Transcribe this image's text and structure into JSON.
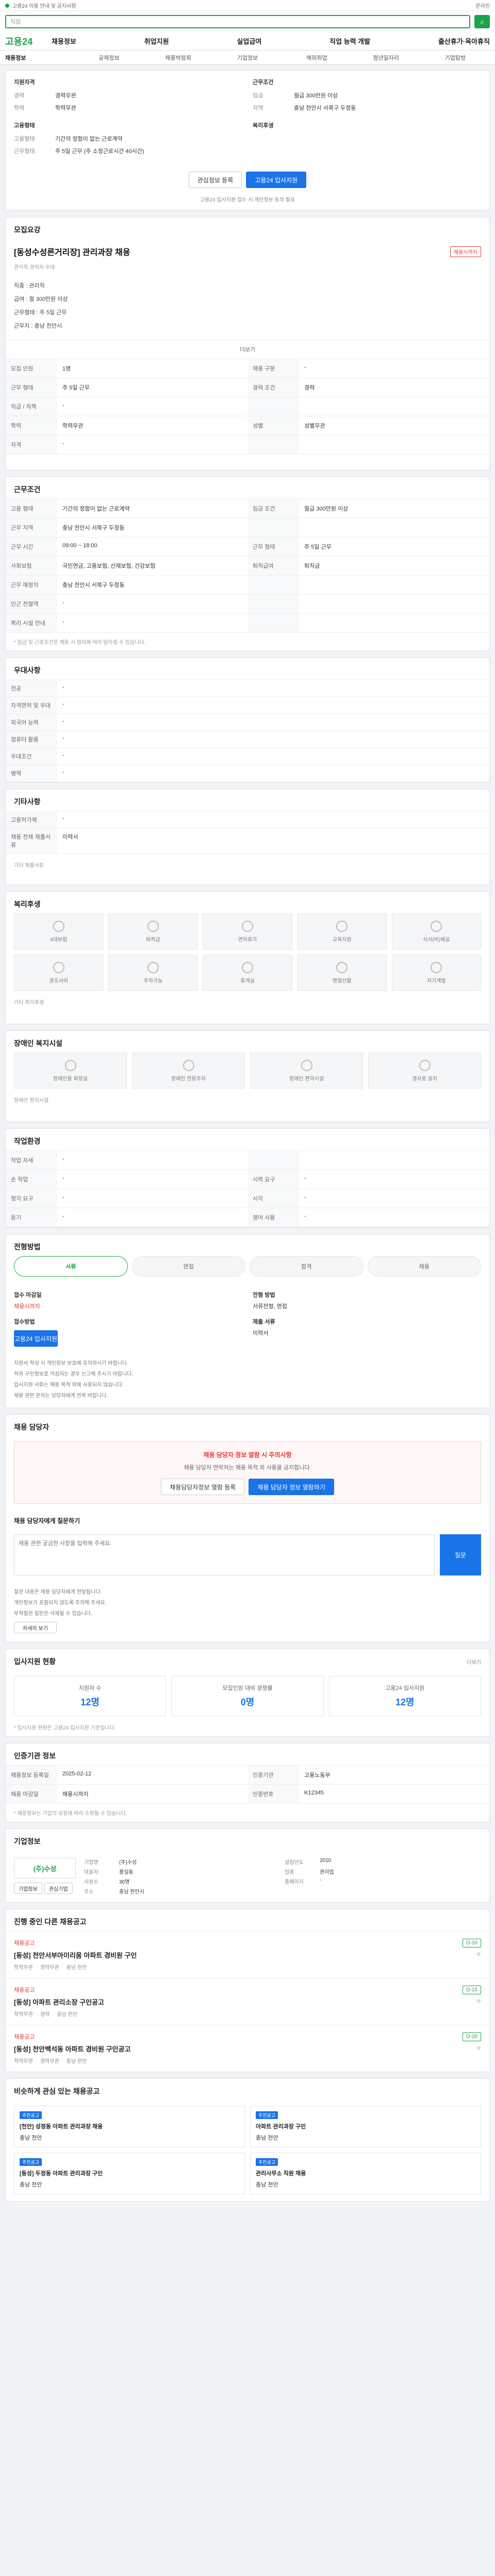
{
  "topbar": {
    "notice": "고용24 이용 안내 및 공지사항",
    "status": "온라인"
  },
  "search": {
    "placeholder": "직업"
  },
  "gnb": {
    "logo": "고용24",
    "menu": [
      "채용정보",
      "취업지원",
      "실업급여",
      "직업 능력 개발",
      "출산휴가·육아휴직"
    ]
  },
  "subnav": [
    "채용정보",
    "공채정보",
    "채용박람회",
    "기업정보",
    "해외취업",
    "청년일자리",
    "기업탐방"
  ],
  "summary": {
    "left_title": "지원자격",
    "left_rows": [
      [
        "경력",
        "경력무관"
      ],
      [
        "학력",
        "학력무관"
      ]
    ],
    "right_title": "근무조건",
    "right_rows": [
      [
        "임금",
        "월급 300만원 이상"
      ],
      [
        "지역",
        "충남 천안시 서북구 두정동"
      ]
    ],
    "mid_left_title": "고용형태",
    "mid_left_rows": [
      [
        "고용형태",
        "기간의 정함이 없는 근로계약"
      ],
      [
        "근무형태",
        "주 5일 근무 (주 소정근로시간 40시간)"
      ]
    ],
    "mid_right_title": "복리후생",
    "interest_btn": "관심정보 등록",
    "apply_btn": "고용24 입사지원",
    "footnote": "고용24 입사지원 접수 시 개인정보 동의 필요"
  },
  "recruit": {
    "section_title": "모집요강",
    "job_title": "[동성수성른거리장] 관리과장 채용",
    "status_tag": "채용시까지",
    "summary_line": "관리직 경력자 우대",
    "check_items": [
      "직종 : 관리직",
      "급여 : 월 300만원 이상",
      "근무형태 : 주 5일 근무",
      "근무지 : 충남 천안시"
    ],
    "more": "더보기",
    "grid": [
      [
        "모집 인원",
        "1명",
        "채용 구분",
        "-"
      ],
      [
        "근무 형태",
        "주 5일 근무",
        "경력 조건",
        "경력"
      ],
      [
        "직급 / 직책",
        "-",
        "",
        ""
      ],
      [
        "학력",
        "학력무관",
        "성별",
        "성별무관"
      ],
      [
        "자격",
        "-",
        "",
        ""
      ]
    ]
  },
  "conditions": {
    "section_title": "근무조건",
    "grid": [
      [
        "고용 형태",
        "기간의 정함이 없는 근로계약",
        "임금 조건",
        "월급 300만원 이상"
      ],
      [
        "근무 지역",
        "충남 천안시 서북구 두정동",
        "",
        ""
      ],
      [
        "근무 시간",
        "09:00 ~ 18:00",
        "근무 형태",
        "주 5일 근무"
      ],
      [
        "사회보험",
        "국민연금, 고용보험, 산재보험, 건강보험",
        "퇴직급여",
        "퇴직금"
      ],
      [
        "근무 예정지",
        "충남 천안시 서북구 두정동",
        "",
        ""
      ],
      [
        "인근 전철역",
        "-",
        "",
        ""
      ],
      [
        "복리 시설 안내",
        "-",
        "",
        ""
      ]
    ],
    "footnote": "* 임금 및 근로조건은 채용 시 협의에 따라 달라질 수 있습니다."
  },
  "prefer": {
    "section_title": "우대사항",
    "rows": [
      [
        "전공",
        "-"
      ],
      [
        "자격면허 및 우대",
        "-"
      ],
      [
        "외국어 능력",
        "-"
      ],
      [
        "컴퓨터 활용",
        "-"
      ],
      [
        "우대조건",
        "-"
      ],
      [
        "병역",
        "-"
      ]
    ]
  },
  "other": {
    "section_title": "기타사항",
    "rows": [
      [
        "고용허가제",
        "-"
      ],
      [
        "채용 전제 제출서류",
        "이력서"
      ]
    ],
    "extra": "기타 제출서류"
  },
  "welfare": {
    "section_title": "복리후생",
    "items": [
      "4대보험",
      "퇴직금",
      "연차휴가",
      "교육지원",
      "식사(비)제공",
      "경조사비",
      "주차가능",
      "휴게실",
      "명절선물",
      "자기계발"
    ],
    "note": "기타 복리후생"
  },
  "disability": {
    "section_title": "장애인 복지시설",
    "items": [
      "장애인용 화장실",
      "장애인 전용주차",
      "장애인 편의시설",
      "경사로 설치"
    ],
    "note": "장애인 편의시설"
  },
  "work_env": {
    "section_title": "작업환경",
    "grid": [
      [
        "작업 자세",
        "-",
        "",
        ""
      ],
      [
        "손 작업",
        "-",
        "시력 요구",
        "-"
      ],
      [
        "청각 요구",
        "-",
        "시각",
        "-"
      ],
      [
        "듣기",
        "-",
        "영어 사용",
        "-"
      ]
    ]
  },
  "process": {
    "section_title": "전형방법",
    "steps": [
      "서류",
      "면접",
      "합격",
      "채용"
    ],
    "apply_left": [
      [
        "접수 마감일",
        "채용시까지"
      ],
      [
        "접수방법",
        "고용24 입사지원"
      ]
    ],
    "apply_right": [
      [
        "전형 방법",
        "서류전형, 면접"
      ],
      [
        "제출 서류",
        "이력서"
      ]
    ],
    "apply_btn": "고용24 입사지원",
    "bullets": [
      "지원서 작성 시 개인정보 보호에 유의하시기 바랍니다.",
      "허위 구인정보로 의심되는 경우 신고해 주시기 바랍니다.",
      "입사지원 서류는 채용 목적 외에 사용되지 않습니다.",
      "채용 관련 문의는 담당자에게 연락 바랍니다."
    ]
  },
  "contact": {
    "section_title": "채용 담당자",
    "notice_head": "채용 담당자 정보 열람 시 주의사항",
    "notice_body": "채용 담당자 연락처는 채용 목적 외 사용을 금지합니다.",
    "btn_left": "채용담당자정보 열람 등록",
    "btn_right": "채용 담당자 정보 열람하기"
  },
  "qna": {
    "title": "채용 담당자에게 질문하기",
    "placeholder": "채용 관련 궁금한 사항을 입력해 주세요.",
    "submit": "질문",
    "bullets": [
      "질문 내용은 채용 담당자에게 전달됩니다.",
      "개인정보가 포함되지 않도록 주의해 주세요.",
      "부적절한 질문은 삭제될 수 있습니다."
    ],
    "more_btn": "자세히 보기"
  },
  "stats": {
    "section_title": "입사지원 현황",
    "more": "더보기",
    "items": [
      [
        "지원자 수",
        "12명"
      ],
      [
        "모집인원 대비 경쟁률",
        "0명"
      ],
      [
        "고용24 입사지원",
        "12명"
      ]
    ],
    "footnote": "* 입사지원 현황은 고용24 입사지원 기준입니다."
  },
  "manage": {
    "section_title": "인증기관 정보",
    "grid": [
      [
        "채용정보 등록일",
        "2025-02-12",
        "인증기관",
        "고용노동부"
      ],
      [
        "채용 마감일",
        "채용시까지",
        "인증번호",
        "K12345"
      ]
    ],
    "footnote": "* 채용정보는 기업의 요청에 따라 수정될 수 있습니다."
  },
  "company": {
    "section_title": "기업정보",
    "logo_text": "(주)수성",
    "info": [
      [
        "기업명",
        "(주)수성",
        "설립년도",
        "2010"
      ],
      [
        "대표자",
        "홍길동",
        "업종",
        "관리업"
      ],
      [
        "사원수",
        "30명",
        "홈페이지",
        "-"
      ],
      [
        "주소",
        "충남 천안시",
        "",
        ""
      ]
    ],
    "btn1": "기업정보",
    "btn2": "관심기업"
  },
  "similar": {
    "section_title": "진행 중인 다른 채용공고",
    "jobs": [
      {
        "co": "채용공고",
        "title": "[동성] 천안서부아이리움 아파트 경비원 구인",
        "meta": [
          "학력무관",
          "경력무관",
          "충남 천안"
        ],
        "badge": "D-10"
      },
      {
        "co": "채용공고",
        "title": "[동성] 아파트 관리소장 구인공고",
        "meta": [
          "학력무관",
          "경력",
          "충남 천안"
        ],
        "badge": "D-15"
      },
      {
        "co": "채용공고",
        "title": "[동성] 천안백석동 아파트 경비원 구인공고",
        "meta": [
          "학력무관",
          "경력무관",
          "충남 천안"
        ],
        "badge": "D-20"
      }
    ]
  },
  "recommend": {
    "section_title": "비슷하게 관심 있는 채용공고",
    "items": [
      {
        "tag": "추천공고",
        "title": "[천안] 성정동 아파트 관리과장 채용",
        "sub": "충남 천안"
      },
      {
        "tag": "추천공고",
        "title": "아파트 관리과장 구인",
        "sub": "충남 천안"
      },
      {
        "tag": "추천공고",
        "title": "[동성] 두정동 아파트 관리과장 구인",
        "sub": "충남 천안"
      },
      {
        "tag": "추천공고",
        "title": "관리사무소 직원 채용",
        "sub": "충남 천안"
      }
    ]
  }
}
